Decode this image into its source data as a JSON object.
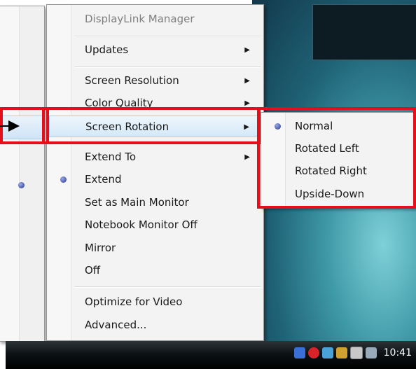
{
  "context_menu": {
    "title": "DisplayLink Manager",
    "items": [
      {
        "label": "Updates",
        "submenu": true
      },
      {
        "label": "Screen Resolution",
        "submenu": true
      },
      {
        "label": "Color Quality",
        "submenu": true
      },
      {
        "label": "Screen Rotation",
        "submenu": true,
        "highlighted": true
      },
      {
        "label": "Extend To",
        "submenu": true
      },
      {
        "label": "Extend",
        "selected": true
      },
      {
        "label": "Set as Main Monitor"
      },
      {
        "label": "Notebook Monitor Off"
      },
      {
        "label": "Mirror"
      },
      {
        "label": "Off"
      },
      {
        "label": "Optimize for Video"
      },
      {
        "label": "Advanced..."
      }
    ],
    "submenu_arrow": "▶"
  },
  "rotation_submenu": {
    "items": [
      {
        "label": "Normal",
        "selected": true
      },
      {
        "label": "Rotated Left"
      },
      {
        "label": "Rotated Right"
      },
      {
        "label": "Upside-Down"
      }
    ]
  },
  "taskbar": {
    "clock": "10:41",
    "tray_icons": [
      "network-icon",
      "security-alert-icon",
      "displaylink-icon",
      "device-icon",
      "display-disconnected-icon",
      "volume-icon"
    ]
  },
  "colors": {
    "highlight_border": "#e3101c",
    "menu_background": "#f3f3f3",
    "bullet": "#25348c"
  }
}
